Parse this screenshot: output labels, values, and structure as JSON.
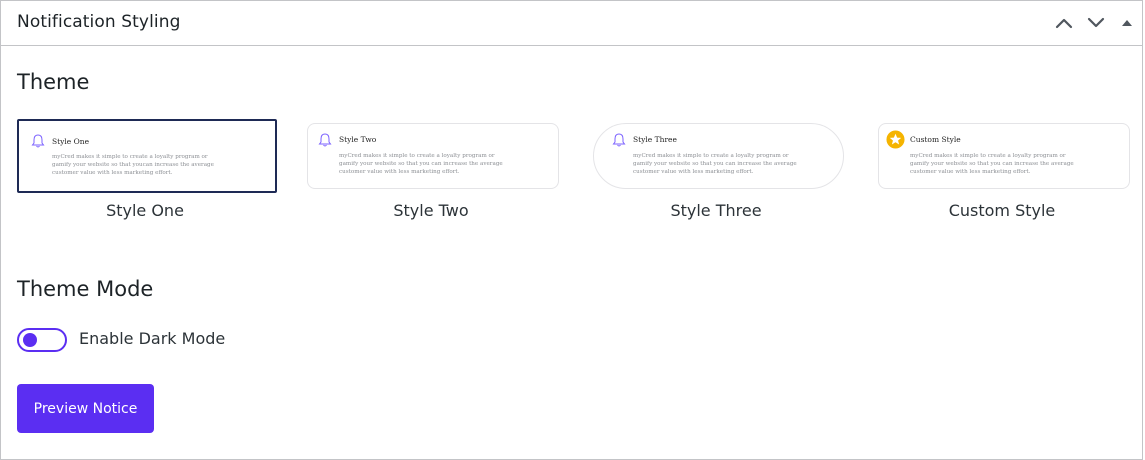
{
  "panel": {
    "title": "Notification Styling"
  },
  "theme": {
    "heading": "Theme",
    "cards": [
      {
        "title": "Style One",
        "body": "myCred makes it simple to create a loyalty program or gamify your website so that youcan increase the average customer value with less marketing effort.",
        "label": "Style One",
        "icon": "bell-icon",
        "selected": true
      },
      {
        "title": "Style Two",
        "body": "myCred makes it simple to create a loyalty program or gamify your website so that you can increase the average customer value with less marketing effort.",
        "label": "Style Two",
        "icon": "bell-icon",
        "selected": false
      },
      {
        "title": "Style Three",
        "body": "myCred makes it simple to create a loyalty program or gamify your website so that you can increase the average customer value with less marketing effort.",
        "label": "Style Three",
        "icon": "bell-icon",
        "selected": false
      },
      {
        "title": "Custom Style",
        "body": "myCred makes it simple to create a loyalty program or gamify your website so that you can increase the average customer value with less marketing effort.",
        "label": "Custom Style",
        "icon": "star-badge-icon",
        "selected": false
      }
    ]
  },
  "theme_mode": {
    "heading": "Theme Mode",
    "toggle_label": "Enable Dark Mode",
    "enabled": false
  },
  "preview_button": {
    "label": "Preview Notice"
  },
  "colors": {
    "accent": "#5b2ef2",
    "selected_border": "#1e2a55",
    "star_badge": "#f5b400"
  }
}
